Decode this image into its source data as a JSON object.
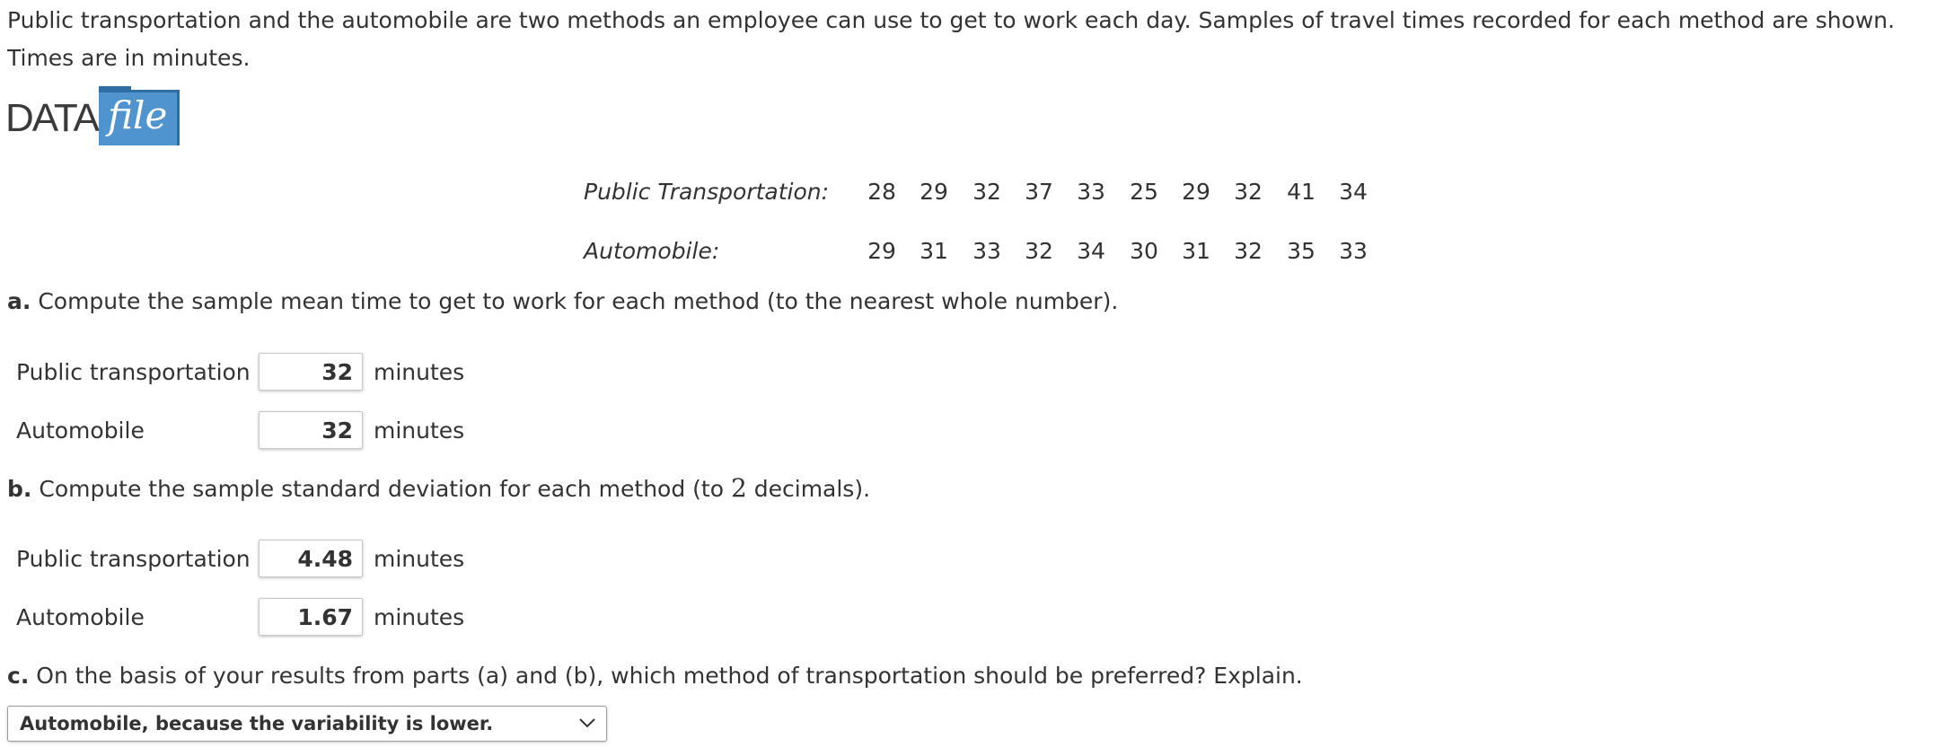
{
  "intro": "Public transportation and the automobile are two methods an employee can use to get to work each day. Samples of travel times recorded for each method are shown. Times are in minutes.",
  "logo": {
    "data_text": "DATA",
    "file_text": "file",
    "accent_color": "#4f93cf"
  },
  "table": {
    "rows": [
      {
        "label": "Public Transportation:",
        "values": [
          "28",
          "29",
          "32",
          "37",
          "33",
          "25",
          "29",
          "32",
          "41",
          "34"
        ]
      },
      {
        "label": "Automobile:",
        "values": [
          "29",
          "31",
          "33",
          "32",
          "34",
          "30",
          "31",
          "32",
          "35",
          "33"
        ]
      }
    ]
  },
  "part_a": {
    "letter": "a.",
    "question": "Compute the sample mean time to get to work for each method (to the nearest whole number).",
    "fields": [
      {
        "label": "Public transportation",
        "value": "32",
        "unit": "minutes"
      },
      {
        "label": "Automobile",
        "value": "32",
        "unit": "minutes"
      }
    ]
  },
  "part_b": {
    "letter": "b.",
    "question_before": "Compute the sample standard deviation for each method (to",
    "decimals": "2",
    "question_after": "decimals).",
    "fields": [
      {
        "label": "Public transportation",
        "value": "4.48",
        "unit": "minutes"
      },
      {
        "label": "Automobile",
        "value": "1.67",
        "unit": "minutes"
      }
    ]
  },
  "part_c": {
    "letter": "c.",
    "question": "On the basis of your results from parts (a) and (b), which method of transportation should be preferred? Explain.",
    "selected_option": "Automobile, because the variability is lower."
  }
}
